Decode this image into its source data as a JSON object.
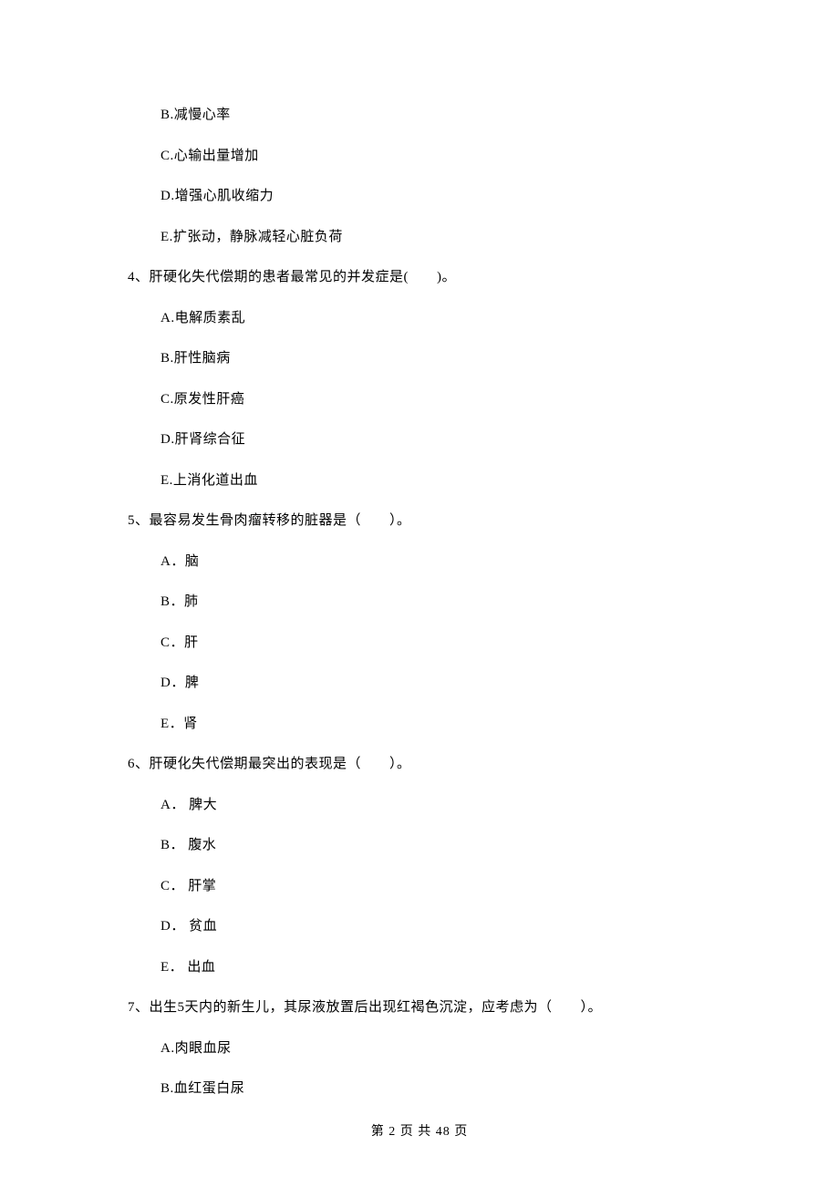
{
  "q3_options": {
    "B": "B.减慢心率",
    "C": "C.心输出量增加",
    "D": "D.增强心肌收缩力",
    "E": "E.扩张动，静脉减轻心脏负荷"
  },
  "q4": {
    "stem": "4、肝硬化失代偿期的患者最常见的并发症是(　　)。",
    "A": "A.电解质素乱",
    "B": "B.肝性脑病",
    "C": "C.原发性肝癌",
    "D": "D.肝肾综合征",
    "E": "E.上消化道出血"
  },
  "q5": {
    "stem": "5、最容易发生骨肉瘤转移的脏器是（　　）。",
    "A": "A．脑",
    "B": "B．肺",
    "C": "C．肝",
    "D": "D．脾",
    "E": "E．肾"
  },
  "q6": {
    "stem": "6、肝硬化失代偿期最突出的表现是（　　）。",
    "A": "A． 脾大",
    "B": "B． 腹水",
    "C": "C． 肝掌",
    "D": "D． 贫血",
    "E": "E． 出血"
  },
  "q7": {
    "stem": "7、出生5天内的新生儿，其尿液放置后出现红褐色沉淀，应考虑为（　　）。",
    "A": "A.肉眼血尿",
    "B": "B.血红蛋白尿"
  },
  "footer": "第 2 页 共 48 页"
}
